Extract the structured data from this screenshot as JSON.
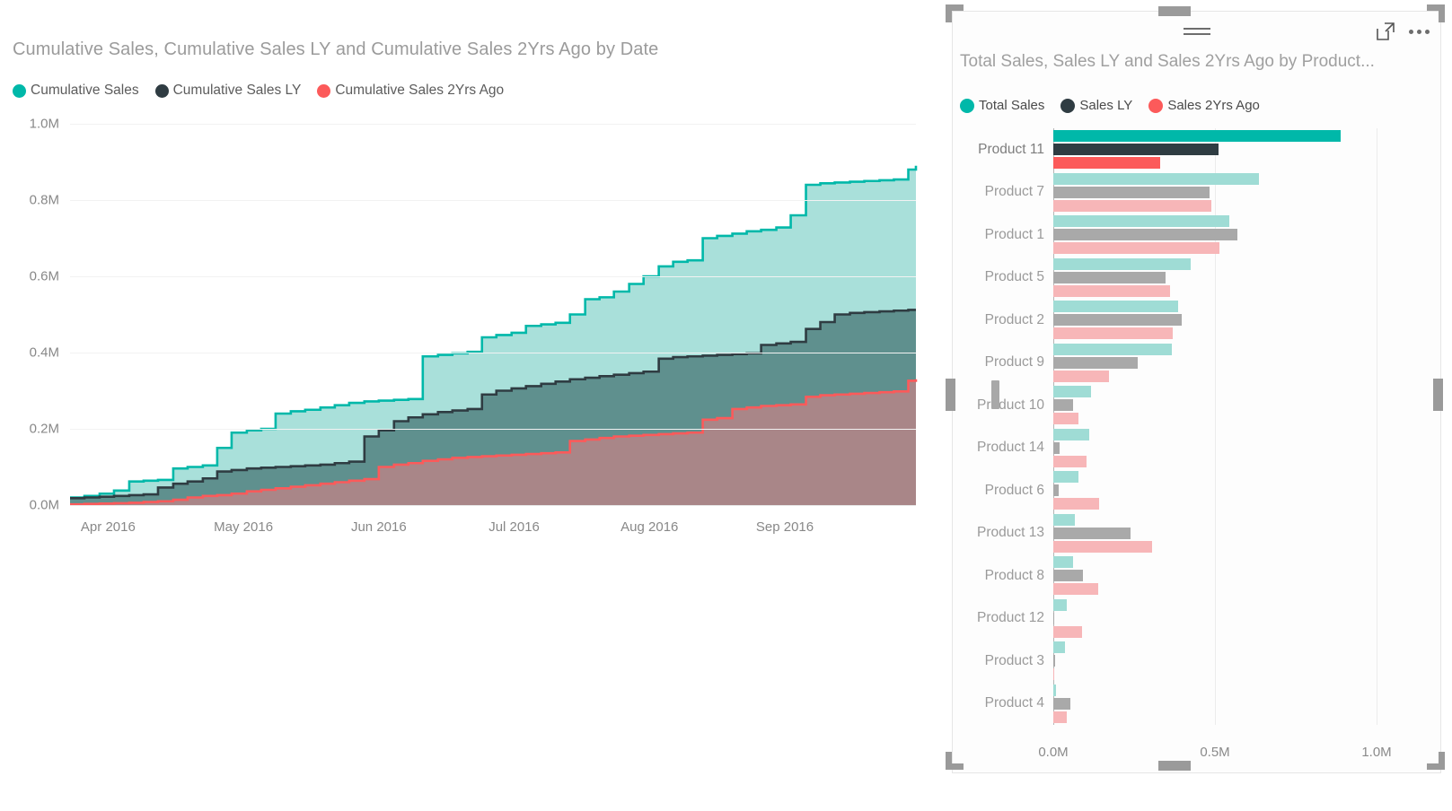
{
  "area_visual": {
    "title": "Cumulative Sales, Cumulative Sales LY and Cumulative Sales 2Yrs Ago by Date",
    "legend": [
      {
        "label": "Cumulative Sales",
        "color": "#00b8a9"
      },
      {
        "label": "Cumulative Sales LY",
        "color": "#2f3c42"
      },
      {
        "label": "Cumulative Sales 2Yrs Ago",
        "color": "#fc5a5a"
      }
    ]
  },
  "bar_visual": {
    "title": "Total Sales, Sales LY and Sales 2Yrs Ago by Product...",
    "legend": [
      {
        "label": "Total Sales",
        "color": "#00b8a9"
      },
      {
        "label": "Sales LY",
        "color": "#2f3c42"
      },
      {
        "label": "Sales 2Yrs Ago",
        "color": "#fc5a5a"
      }
    ],
    "header": {
      "drag_grip": "drag-grip-icon",
      "focus_mode": "focus-mode-icon",
      "more_options": "more-options-icon"
    },
    "selected_category": "Product 11"
  },
  "chart_data": [
    {
      "type": "area",
      "title": "Cumulative Sales, Cumulative Sales LY and Cumulative Sales 2Yrs Ago by Date",
      "xlabel": "",
      "ylabel": "",
      "ylim": [
        0,
        1000000
      ],
      "yticks": [
        "0.0M",
        "0.2M",
        "0.4M",
        "0.6M",
        "0.8M",
        "1.0M"
      ],
      "ytick_values": [
        0,
        200000,
        400000,
        600000,
        800000,
        1000000
      ],
      "xticks": [
        "Apr 2016",
        "May 2016",
        "Jun 2016",
        "Jul 2016",
        "Aug 2016",
        "Sep 2016"
      ],
      "xtick_positions": [
        0.045,
        0.205,
        0.365,
        0.525,
        0.685,
        0.845
      ],
      "grid": true,
      "legend_position": "top-left",
      "interpolation": "step",
      "series": [
        {
          "name": "Cumulative Sales",
          "color": "#00b8a9",
          "fill": "#a4ded8",
          "x": [
            0.0,
            0.017,
            0.035,
            0.052,
            0.07,
            0.087,
            0.104,
            0.122,
            0.139,
            0.157,
            0.174,
            0.191,
            0.209,
            0.226,
            0.243,
            0.261,
            0.278,
            0.296,
            0.313,
            0.33,
            0.348,
            0.365,
            0.383,
            0.4,
            0.417,
            0.435,
            0.452,
            0.47,
            0.487,
            0.504,
            0.522,
            0.539,
            0.557,
            0.574,
            0.591,
            0.609,
            0.626,
            0.643,
            0.661,
            0.678,
            0.696,
            0.713,
            0.73,
            0.748,
            0.765,
            0.783,
            0.8,
            0.817,
            0.835,
            0.852,
            0.87,
            0.887,
            0.904,
            0.922,
            0.939,
            0.957,
            0.974,
            0.991,
            1.0
          ],
          "values": [
            20000,
            24000,
            30000,
            38000,
            62000,
            64000,
            66000,
            96000,
            100000,
            104000,
            150000,
            190000,
            196000,
            200000,
            240000,
            246000,
            250000,
            256000,
            262000,
            268000,
            272000,
            274000,
            276000,
            278000,
            390000,
            394000,
            398000,
            402000,
            440000,
            446000,
            452000,
            470000,
            474000,
            478000,
            500000,
            540000,
            545000,
            560000,
            580000,
            600000,
            626000,
            638000,
            642000,
            700000,
            706000,
            712000,
            718000,
            722000,
            728000,
            760000,
            840000,
            844000,
            846000,
            848000,
            850000,
            852000,
            854000,
            880000,
            890000
          ]
        },
        {
          "name": "Cumulative Sales LY",
          "color": "#2f3c42",
          "fill": "#5b8b8a",
          "x": [
            0.0,
            0.017,
            0.035,
            0.052,
            0.07,
            0.087,
            0.104,
            0.122,
            0.139,
            0.157,
            0.174,
            0.191,
            0.209,
            0.226,
            0.243,
            0.261,
            0.278,
            0.296,
            0.313,
            0.33,
            0.348,
            0.365,
            0.383,
            0.4,
            0.417,
            0.435,
            0.452,
            0.47,
            0.487,
            0.504,
            0.522,
            0.539,
            0.557,
            0.574,
            0.591,
            0.609,
            0.626,
            0.643,
            0.661,
            0.678,
            0.696,
            0.713,
            0.73,
            0.748,
            0.765,
            0.783,
            0.8,
            0.817,
            0.835,
            0.852,
            0.87,
            0.887,
            0.904,
            0.922,
            0.939,
            0.957,
            0.974,
            0.991,
            1.0
          ],
          "values": [
            18000,
            20000,
            22000,
            24000,
            26000,
            28000,
            46000,
            56000,
            62000,
            70000,
            88000,
            92000,
            96000,
            98000,
            100000,
            102000,
            104000,
            106000,
            110000,
            114000,
            180000,
            196000,
            220000,
            230000,
            238000,
            244000,
            248000,
            252000,
            290000,
            300000,
            306000,
            312000,
            318000,
            324000,
            330000,
            334000,
            338000,
            342000,
            346000,
            350000,
            384000,
            388000,
            390000,
            392000,
            394000,
            396000,
            398000,
            420000,
            424000,
            428000,
            462000,
            480000,
            500000,
            504000,
            506000,
            508000,
            510000,
            512000,
            512000
          ]
        },
        {
          "name": "Cumulative Sales 2Yrs Ago",
          "color": "#fc5a5a",
          "fill": "#ad8688",
          "x": [
            0.0,
            0.017,
            0.035,
            0.052,
            0.07,
            0.087,
            0.104,
            0.122,
            0.139,
            0.157,
            0.174,
            0.191,
            0.209,
            0.226,
            0.243,
            0.261,
            0.278,
            0.296,
            0.313,
            0.33,
            0.348,
            0.365,
            0.383,
            0.4,
            0.417,
            0.435,
            0.452,
            0.47,
            0.487,
            0.504,
            0.522,
            0.539,
            0.557,
            0.574,
            0.591,
            0.609,
            0.626,
            0.643,
            0.661,
            0.678,
            0.696,
            0.713,
            0.73,
            0.748,
            0.765,
            0.783,
            0.8,
            0.817,
            0.835,
            0.852,
            0.87,
            0.887,
            0.904,
            0.922,
            0.939,
            0.957,
            0.974,
            0.991,
            1.0
          ],
          "values": [
            2000,
            3000,
            4000,
            5000,
            6000,
            8000,
            10000,
            14000,
            20000,
            24000,
            26000,
            30000,
            36000,
            40000,
            44000,
            48000,
            52000,
            56000,
            60000,
            64000,
            68000,
            100000,
            106000,
            110000,
            116000,
            120000,
            124000,
            126000,
            128000,
            130000,
            132000,
            134000,
            136000,
            138000,
            168000,
            172000,
            176000,
            180000,
            182000,
            184000,
            186000,
            188000,
            190000,
            224000,
            228000,
            252000,
            256000,
            260000,
            262000,
            264000,
            284000,
            288000,
            290000,
            292000,
            294000,
            296000,
            298000,
            326000,
            330000
          ]
        }
      ]
    },
    {
      "type": "bar",
      "orientation": "horizontal",
      "title": "Total Sales, Sales LY and Sales 2Yrs Ago by Product...",
      "xlabel": "",
      "ylabel": "",
      "xlim": [
        0,
        1000000
      ],
      "xticks": [
        "0.0M",
        "0.5M",
        "1.0M"
      ],
      "xtick_values": [
        0,
        500000,
        1000000
      ],
      "grid": true,
      "legend_position": "top-left",
      "highlighted": "Product 11",
      "categories": [
        "Product 11",
        "Product 7",
        "Product 1",
        "Product 5",
        "Product 2",
        "Product 9",
        "Product 10",
        "Product 14",
        "Product 6",
        "Product 13",
        "Product 8",
        "Product 12",
        "Product 3",
        "Product 4"
      ],
      "series": [
        {
          "name": "Total Sales",
          "color": "#00b8a9",
          "dim_color": "#9fdcd5",
          "values": [
            890000,
            635000,
            545000,
            425000,
            385000,
            368000,
            118000,
            112000,
            78000,
            68000,
            62000,
            42000,
            35000,
            8000
          ]
        },
        {
          "name": "Sales LY",
          "color": "#2f3c42",
          "dim_color": "#a9a9a9",
          "values": [
            510000,
            483000,
            570000,
            348000,
            398000,
            262000,
            62000,
            20000,
            18000,
            240000,
            92000,
            4000,
            5000,
            52000
          ]
        },
        {
          "name": "Sales 2Yrs Ago",
          "color": "#fc5a5a",
          "dim_color": "#f7b6b8",
          "values": [
            330000,
            490000,
            515000,
            362000,
            370000,
            172000,
            78000,
            102000,
            142000,
            305000,
            138000,
            88000,
            3000,
            42000
          ]
        }
      ]
    }
  ]
}
